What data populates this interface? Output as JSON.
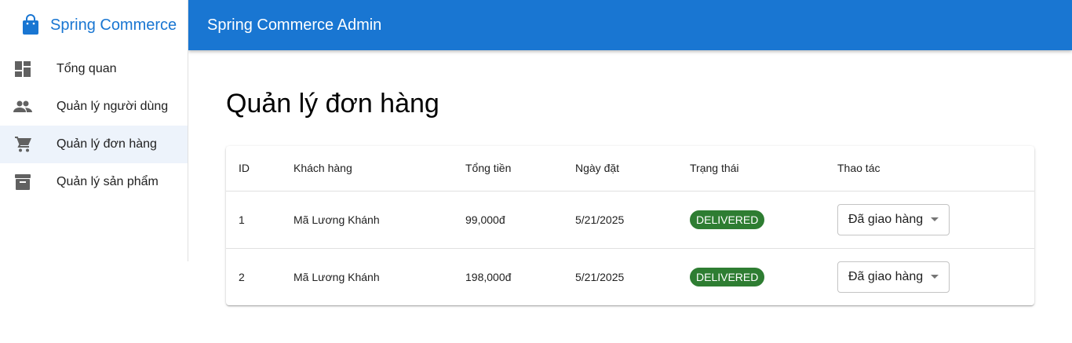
{
  "brand": {
    "name": "Spring Commerce",
    "icon": "shopping-bag-icon",
    "color": "#1976d2"
  },
  "appbar": {
    "title": "Spring Commerce Admin",
    "color": "#1976d2"
  },
  "sidebar": {
    "items": [
      {
        "label": "Tổng quan",
        "icon": "dashboard-icon",
        "active": false
      },
      {
        "label": "Quản lý người dùng",
        "icon": "people-icon",
        "active": false
      },
      {
        "label": "Quản lý đơn hàng",
        "icon": "cart-icon",
        "active": true
      },
      {
        "label": "Quản lý sản phẩm",
        "icon": "archive-icon",
        "active": false
      }
    ]
  },
  "main": {
    "title": "Quản lý đơn hàng",
    "table": {
      "headers": [
        "ID",
        "Khách hàng",
        "Tổng tiền",
        "Ngày đặt",
        "Trạng thái",
        "Thao tác"
      ],
      "rows": [
        {
          "id": "1",
          "customer": "Mã Lương Khánh",
          "total": "99,000đ",
          "date": "5/21/2025",
          "status": "DELIVERED",
          "action": "Đã giao hàng"
        },
        {
          "id": "2",
          "customer": "Mã Lương Khánh",
          "total": "198,000đ",
          "date": "5/21/2025",
          "status": "DELIVERED",
          "action": "Đã giao hàng"
        }
      ]
    }
  },
  "colors": {
    "status_delivered": "#2e7d32",
    "active_nav_bg": "#edf3fb"
  }
}
